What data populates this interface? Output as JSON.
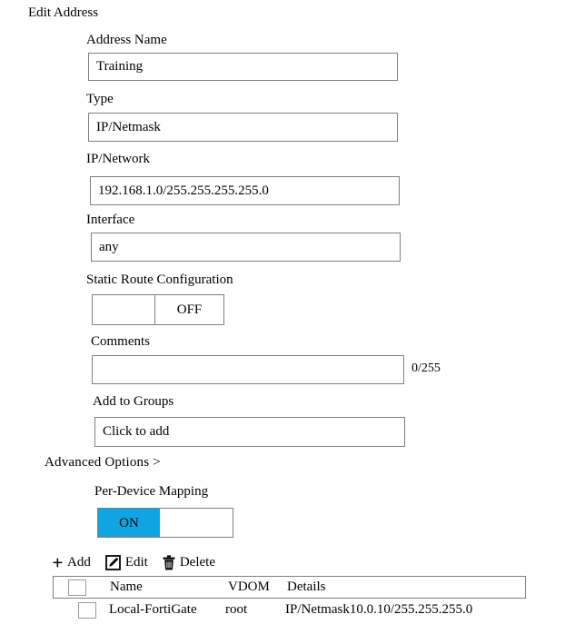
{
  "form": {
    "title": "Edit Address",
    "advanced_options_label": "Advanced  Options >",
    "fields": {
      "address_name": {
        "label": "Address Name",
        "value": "Training"
      },
      "type": {
        "label": "Type",
        "value": "IP/Netmask"
      },
      "ip_network": {
        "label": "IP/Network",
        "value": "192.168.1.0/255.255.255.255.0"
      },
      "interface": {
        "label": "Interface",
        "value": "any"
      },
      "static_route": {
        "label": "Static Route Configuration",
        "state": "OFF",
        "on_label": "",
        "off_label": "OFF"
      },
      "comments": {
        "label": "Comments",
        "value": "",
        "counter": "0/255"
      },
      "add_to_groups": {
        "label": "Add to Groups",
        "value": "Click to add"
      },
      "per_device_mapping": {
        "label": "Per-Device Mapping",
        "state": "ON",
        "on_label": "ON",
        "off_label": ""
      }
    }
  },
  "toolbar": {
    "add_label": "Add",
    "add_icon": "plus-icon",
    "edit_label": "Edit",
    "edit_icon": "pencil-square-icon",
    "delete_label": "Delete",
    "delete_icon": "trash-icon"
  },
  "table": {
    "columns": [
      "Name",
      "VDOM",
      "Details"
    ],
    "rows": [
      {
        "name": "Local-FortiGate",
        "vdom": "root",
        "details": "IP/Netmask10.0.10/255.255.255.0",
        "selected": false
      }
    ]
  },
  "colors": {
    "toggle_on": "#0fa5e3",
    "border": "#808080",
    "text": "#000000",
    "background": "#ffffff"
  }
}
